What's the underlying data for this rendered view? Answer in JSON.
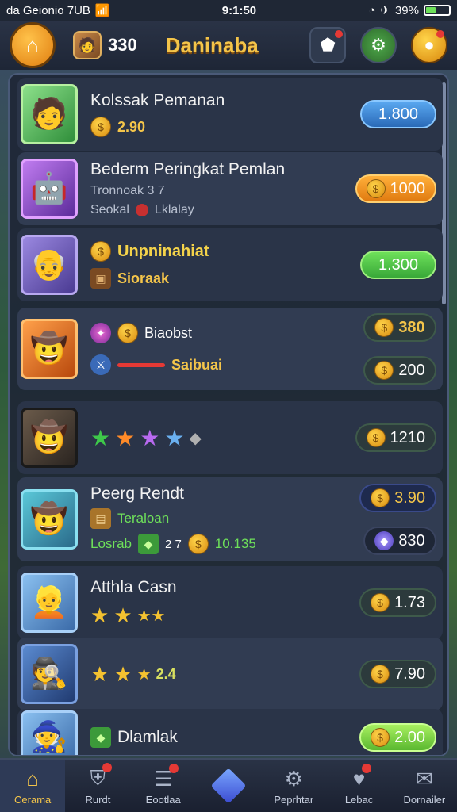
{
  "status_bar": {
    "carrier": "da Geionio 7UB",
    "time": "9:1:50",
    "battery": "39%",
    "battery_level": 0.39
  },
  "header": {
    "player_score": "330",
    "title": "Daninaba"
  },
  "rows": [
    {
      "name": "Kolssak Pemanan",
      "coins": "2.90",
      "price": "1.800"
    },
    {
      "name": "Bederm Peringkat Pemlan",
      "sub1": "Tronnoak 3 7",
      "sub2": "Seokal",
      "sub2b": "Lklalay",
      "price": "1000"
    },
    {
      "name": "Unpninahiat",
      "sub": "Sioraak",
      "price": "1.300"
    },
    {
      "label": "Biaobst",
      "sub": "Saibuai",
      "price_top": "380",
      "price_bottom": "200"
    },
    {
      "price": "1210"
    },
    {
      "name": "Peerg Rendt",
      "sub": "Teraloan",
      "extra_a": "Losrab",
      "extra_b": "2 7",
      "extra_c": "10.135",
      "price_top": "3.90",
      "price_bottom": "830"
    },
    {
      "name": "Atthla Casn",
      "price": "1.73"
    },
    {
      "stars_text": "2.4",
      "price": "7.90"
    },
    {
      "name": "Dlamlak",
      "price": "2.00"
    }
  ],
  "nav": [
    {
      "label": "Cerama",
      "icon": "home-icon"
    },
    {
      "label": "Rurdt",
      "icon": "shield-icon"
    },
    {
      "label": "Eootlaa",
      "icon": "list-icon"
    },
    {
      "label": "",
      "icon": "gem-icon"
    },
    {
      "label": "Peprhtar",
      "icon": "gear-icon"
    },
    {
      "label": "Lebac",
      "icon": "heart-icon"
    },
    {
      "label": "Dornailer",
      "icon": "mail-icon"
    }
  ]
}
